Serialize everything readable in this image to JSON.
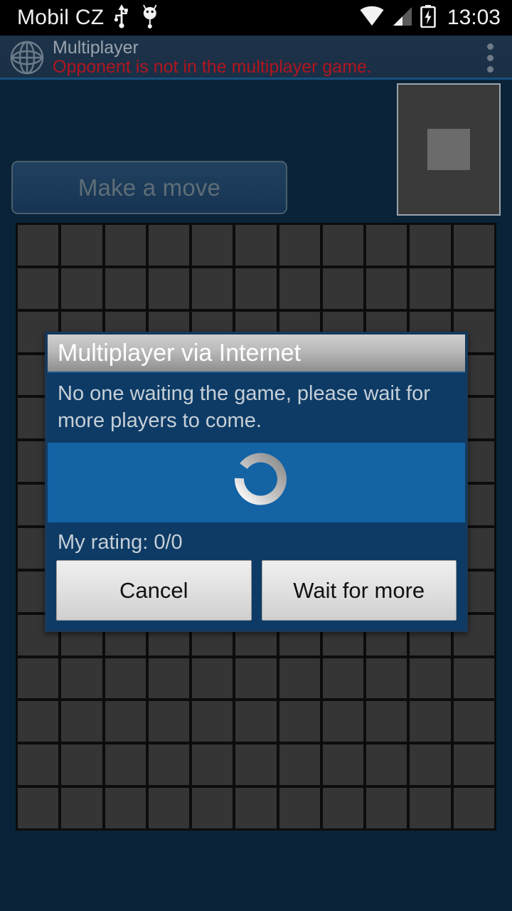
{
  "status_bar": {
    "carrier": "Mobil CZ",
    "clock": "13:03",
    "icons": [
      "usb-icon",
      "android-bug-icon",
      "wifi-icon",
      "cellular-signal-icon",
      "battery-charging-icon"
    ]
  },
  "action_bar": {
    "icon": "globe-icon",
    "title": "Multiplayer",
    "subtitle": "Opponent is not in the multiplayer game.",
    "subtitle_color": "#b01520",
    "overflow_icon": "overflow-menu-icon"
  },
  "game": {
    "make_move_label": "Make a move",
    "make_move_enabled": false,
    "preview_icon": "next-piece-preview",
    "board": {
      "columns": 11,
      "rows": 14,
      "cell_color": "#353535",
      "grid_line_color": "#0c0c0c"
    },
    "background_color": "#0a2338"
  },
  "dialog": {
    "title": "Multiplayer via Internet",
    "message": "No one waiting the game, please wait for more players to come.",
    "progress_icon": "loading-spinner",
    "rating_label": "My rating: 0/0",
    "buttons": [
      {
        "label": "Cancel",
        "name": "cancel-button"
      },
      {
        "label": "Wait for more",
        "name": "wait-for-more-button"
      }
    ],
    "accent_color": "#1363a5",
    "body_color": "#0d3b66"
  }
}
